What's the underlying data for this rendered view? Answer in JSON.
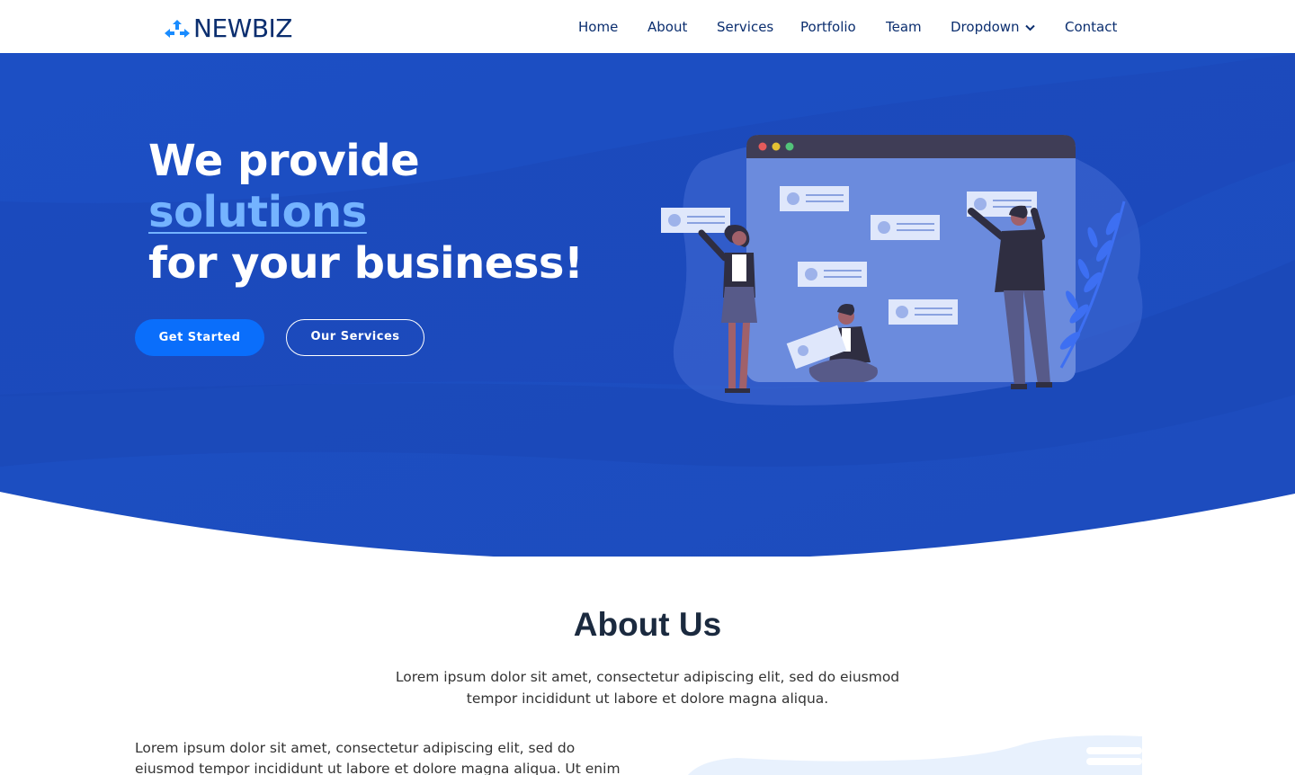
{
  "brand": {
    "name": "NEWBIZ",
    "logo_icon": "arrows-logo-icon"
  },
  "nav": {
    "items": [
      {
        "label": "Home"
      },
      {
        "label": "About"
      },
      {
        "label": "Services"
      },
      {
        "label": "Portfolio"
      },
      {
        "label": "Team"
      },
      {
        "label": "Dropdown",
        "icon": "chevron-down-icon"
      },
      {
        "label": "Contact"
      }
    ]
  },
  "hero": {
    "line1": "We provide",
    "accent": "solutions",
    "line3": "for your business!",
    "primary_button": "Get Started",
    "secondary_button": "Our Services",
    "illustration": "team-board-illustration"
  },
  "about": {
    "title": "About Us",
    "description": "Lorem ipsum dolor sit amet, consectetur adipiscing elit, sed do eiusmod tempor incididunt ut labore et dolore magna aliqua.",
    "body": "Lorem ipsum dolor sit amet, consectetur adipiscing elit, sed do eiusmod tempor incididunt ut labore et dolore magna aliqua. Ut enim ad minim"
  },
  "colors": {
    "nav_text": "#0b2e6f",
    "hero_bg": "#1e50c8",
    "hero_accent": "#74b3ff",
    "primary_button": "#0a6efb"
  }
}
